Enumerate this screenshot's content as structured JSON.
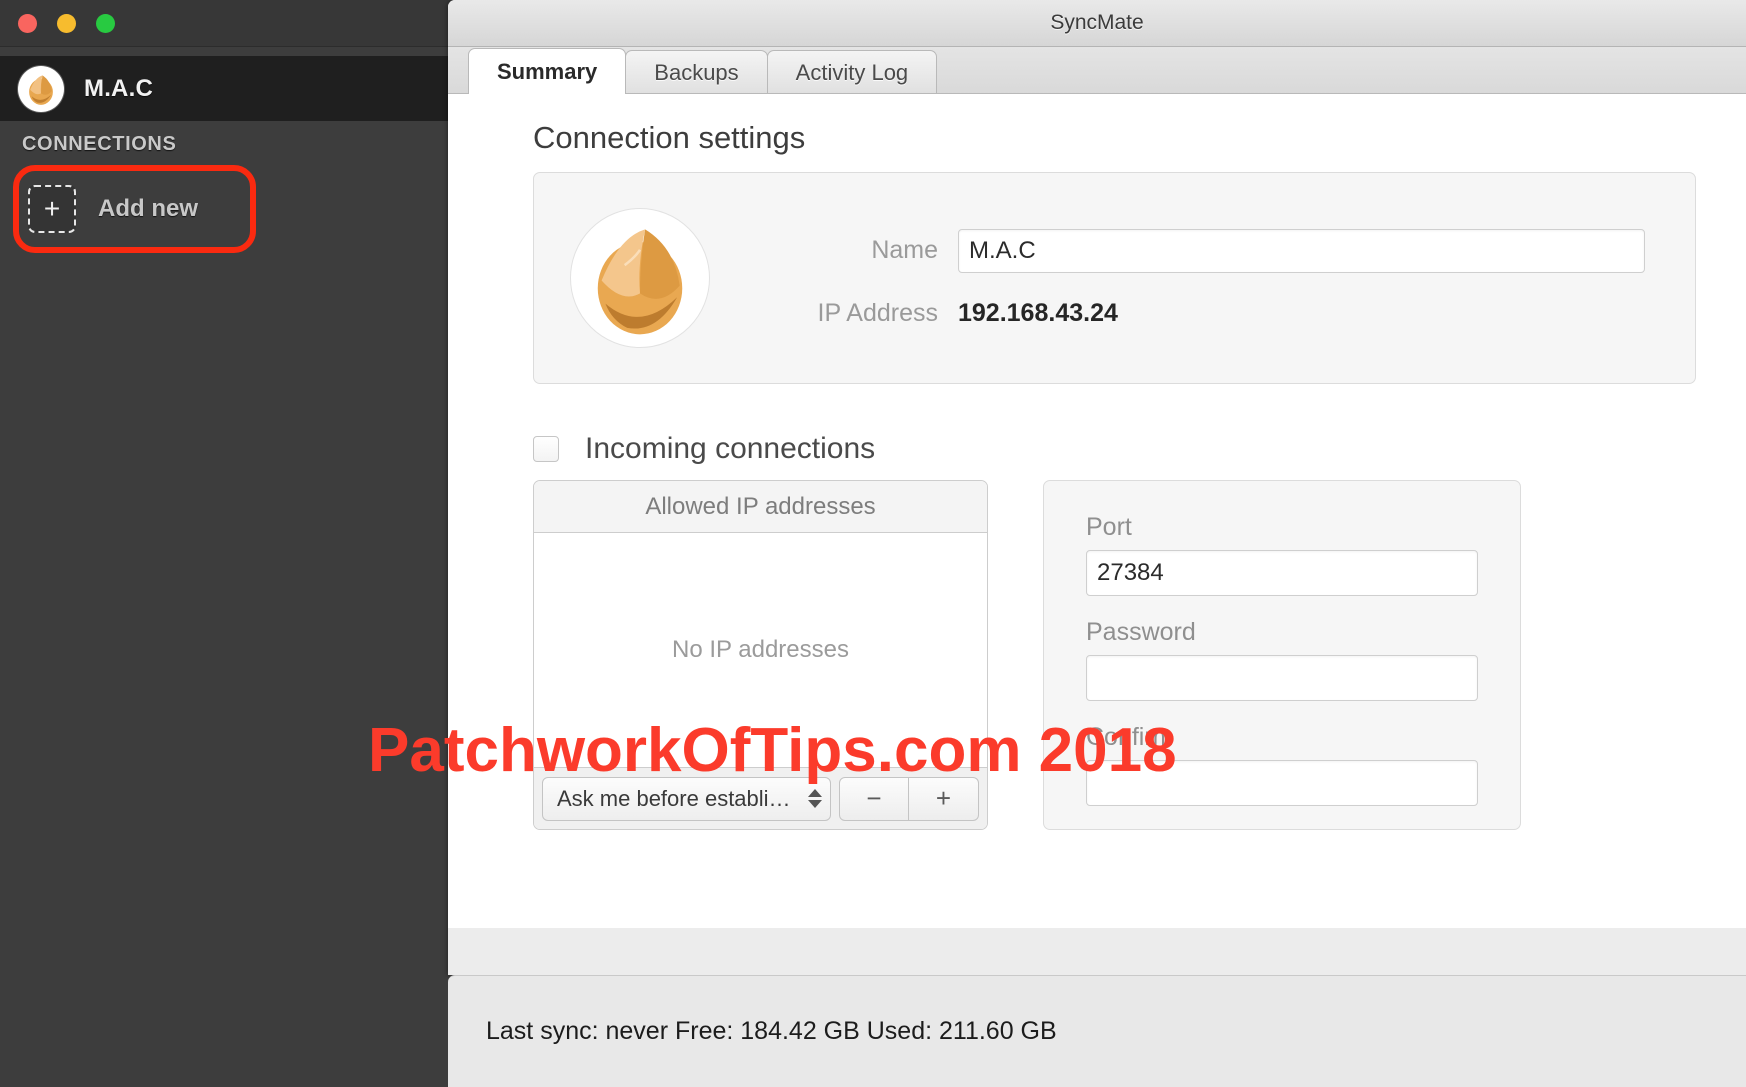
{
  "window": {
    "title": "SyncMate",
    "traffic_lights": [
      "close-button",
      "minimize-button",
      "zoom-button"
    ]
  },
  "sidebar": {
    "account_name": "M.A.C",
    "section_label": "CONNECTIONS",
    "add_new_label": "Add new",
    "add_new_icon": "plus-icon",
    "highlight_color": "#fa2a10"
  },
  "tabs": [
    {
      "label": "Summary",
      "active": true
    },
    {
      "label": "Backups",
      "active": false
    },
    {
      "label": "Activity Log",
      "active": false
    }
  ],
  "main": {
    "section_title": "Connection settings",
    "name_label": "Name",
    "name_value": "M.A.C",
    "name_placeholder": "Name",
    "ip_label": "IP Address",
    "ip_value": "192.168.43.24",
    "incoming_label": "Incoming connections",
    "incoming_checked": false,
    "allowed_ip": {
      "header": "Allowed IP addresses",
      "empty_text": "No IP addresses",
      "entries": [],
      "policy_selected": "Ask me before establi…",
      "remove_label": "−",
      "add_label": "+"
    },
    "security": {
      "port_label": "Port",
      "port_value": "27384",
      "password_label": "Password",
      "password_value": "",
      "confirm_label": "Confirm",
      "confirm_value": ""
    }
  },
  "statusbar": {
    "text": "Last sync: never  Free: 184.42 GB  Used: 211.60 GB"
  },
  "watermark": {
    "text": "PatchworkOfTips.com 2018",
    "color": "#fb3b2b"
  }
}
